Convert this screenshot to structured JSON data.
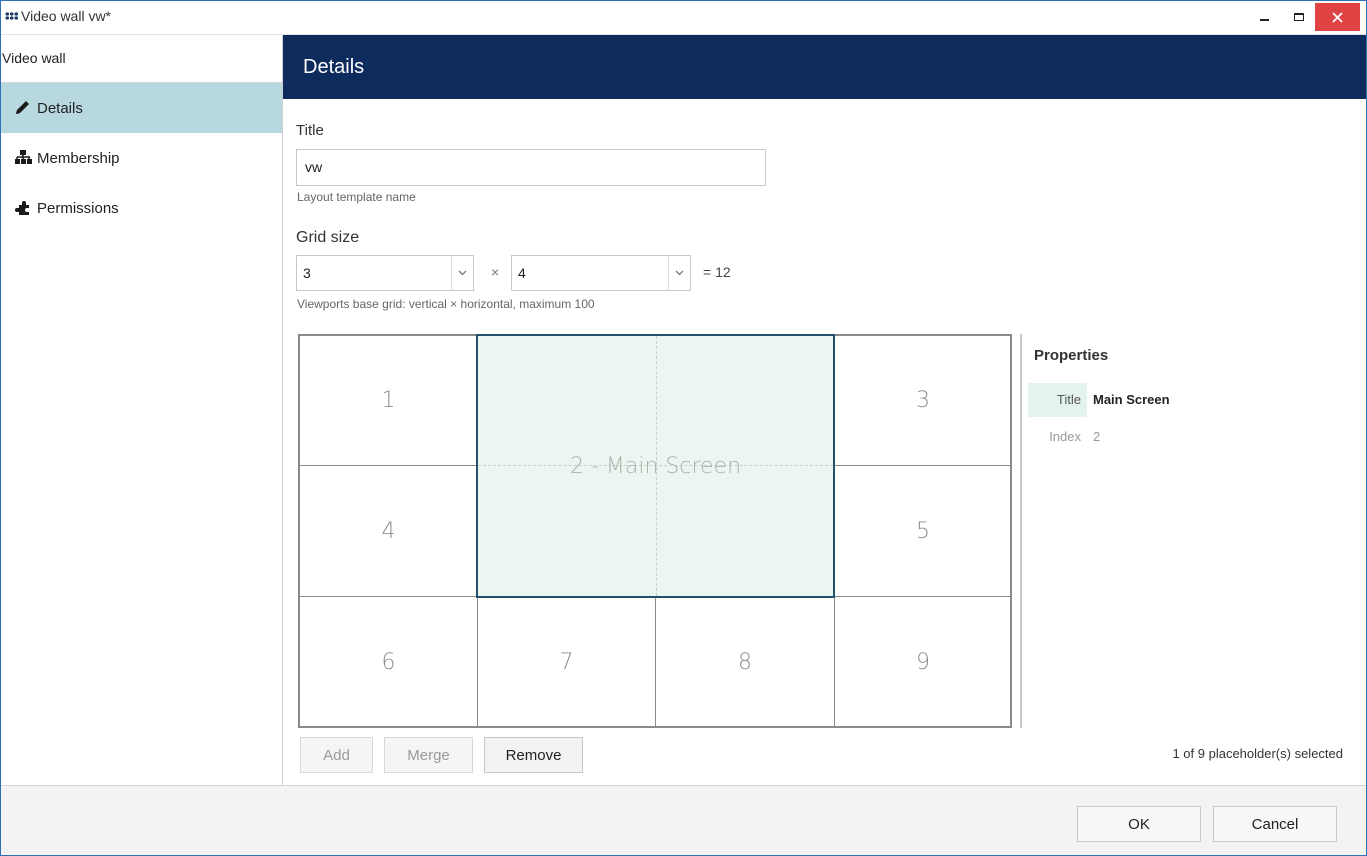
{
  "window": {
    "title": "Video wall vw*"
  },
  "sidebar": {
    "heading": "Video wall",
    "items": [
      {
        "label": "Details",
        "icon": "pencil-icon",
        "active": true
      },
      {
        "label": "Membership",
        "icon": "hierarchy-icon",
        "active": false
      },
      {
        "label": "Permissions",
        "icon": "puzzle-icon",
        "active": false
      }
    ]
  },
  "header": {
    "title": "Details"
  },
  "form": {
    "title_label": "Title",
    "title_value": "vw",
    "title_hint": "Layout template name",
    "grid_label": "Grid size",
    "rows_value": "3",
    "cols_value": "4",
    "times_symbol": "×",
    "total_text": "=  12",
    "grid_hint": "Viewports base grid: vertical × horizontal, maximum 100"
  },
  "layout": {
    "cells": [
      "1",
      "2 - Main Screen",
      "3",
      "4",
      "5",
      "6",
      "7",
      "8",
      "9"
    ],
    "selected_index": 1
  },
  "properties": {
    "heading": "Properties",
    "title_key": "Title",
    "title_value": "Main Screen",
    "index_key": "Index",
    "index_value": "2"
  },
  "actions": {
    "add": "Add",
    "merge": "Merge",
    "remove": "Remove",
    "selection_status": "1 of 9 placeholder(s) selected"
  },
  "footer": {
    "ok": "OK",
    "cancel": "Cancel"
  },
  "colors": {
    "header_bg": "#0d2b5c",
    "active_nav": "#b8d8e0",
    "selected_cell": "#eaf6ef",
    "close_button": "#e04343"
  }
}
